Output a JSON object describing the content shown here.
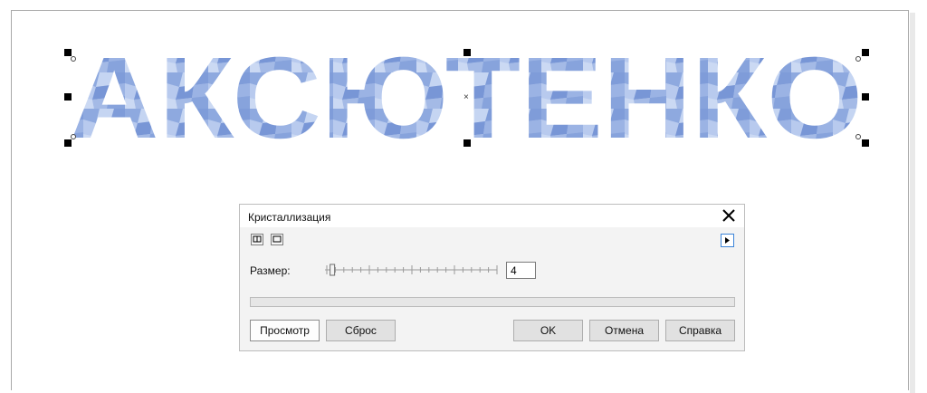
{
  "canvas": {
    "text": "АКСЮТЕНКО",
    "fill_color": "#8aa6dc"
  },
  "dialog": {
    "title": "Кристаллизация",
    "size_label": "Размер:",
    "size_value": "4",
    "size_min": 1,
    "size_max": 100,
    "progress": 0,
    "buttons": {
      "preview": "Просмотр",
      "reset": "Сброс",
      "ok": "OK",
      "cancel": "Отмена",
      "help": "Справка"
    }
  },
  "icons": {
    "close": "close-icon",
    "split_view": "split-view-icon",
    "single_view": "single-view-icon",
    "expand": "play-arrow-icon"
  }
}
